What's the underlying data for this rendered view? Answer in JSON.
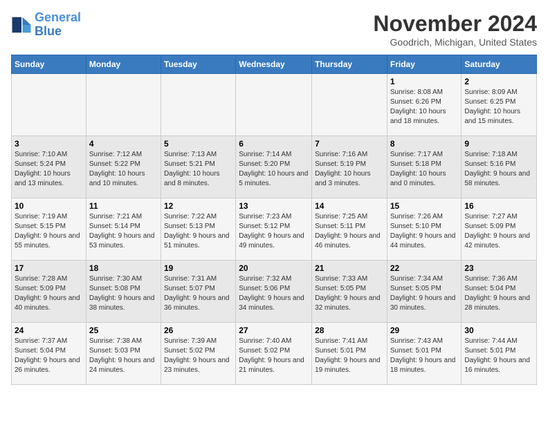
{
  "header": {
    "logo_line1": "General",
    "logo_line2": "Blue",
    "month": "November 2024",
    "location": "Goodrich, Michigan, United States"
  },
  "weekdays": [
    "Sunday",
    "Monday",
    "Tuesday",
    "Wednesday",
    "Thursday",
    "Friday",
    "Saturday"
  ],
  "weeks": [
    [
      {
        "day": "",
        "info": ""
      },
      {
        "day": "",
        "info": ""
      },
      {
        "day": "",
        "info": ""
      },
      {
        "day": "",
        "info": ""
      },
      {
        "day": "",
        "info": ""
      },
      {
        "day": "1",
        "info": "Sunrise: 8:08 AM\nSunset: 6:26 PM\nDaylight: 10 hours and 18 minutes."
      },
      {
        "day": "2",
        "info": "Sunrise: 8:09 AM\nSunset: 6:25 PM\nDaylight: 10 hours and 15 minutes."
      }
    ],
    [
      {
        "day": "3",
        "info": "Sunrise: 7:10 AM\nSunset: 5:24 PM\nDaylight: 10 hours and 13 minutes."
      },
      {
        "day": "4",
        "info": "Sunrise: 7:12 AM\nSunset: 5:22 PM\nDaylight: 10 hours and 10 minutes."
      },
      {
        "day": "5",
        "info": "Sunrise: 7:13 AM\nSunset: 5:21 PM\nDaylight: 10 hours and 8 minutes."
      },
      {
        "day": "6",
        "info": "Sunrise: 7:14 AM\nSunset: 5:20 PM\nDaylight: 10 hours and 5 minutes."
      },
      {
        "day": "7",
        "info": "Sunrise: 7:16 AM\nSunset: 5:19 PM\nDaylight: 10 hours and 3 minutes."
      },
      {
        "day": "8",
        "info": "Sunrise: 7:17 AM\nSunset: 5:18 PM\nDaylight: 10 hours and 0 minutes."
      },
      {
        "day": "9",
        "info": "Sunrise: 7:18 AM\nSunset: 5:16 PM\nDaylight: 9 hours and 58 minutes."
      }
    ],
    [
      {
        "day": "10",
        "info": "Sunrise: 7:19 AM\nSunset: 5:15 PM\nDaylight: 9 hours and 55 minutes."
      },
      {
        "day": "11",
        "info": "Sunrise: 7:21 AM\nSunset: 5:14 PM\nDaylight: 9 hours and 53 minutes."
      },
      {
        "day": "12",
        "info": "Sunrise: 7:22 AM\nSunset: 5:13 PM\nDaylight: 9 hours and 51 minutes."
      },
      {
        "day": "13",
        "info": "Sunrise: 7:23 AM\nSunset: 5:12 PM\nDaylight: 9 hours and 49 minutes."
      },
      {
        "day": "14",
        "info": "Sunrise: 7:25 AM\nSunset: 5:11 PM\nDaylight: 9 hours and 46 minutes."
      },
      {
        "day": "15",
        "info": "Sunrise: 7:26 AM\nSunset: 5:10 PM\nDaylight: 9 hours and 44 minutes."
      },
      {
        "day": "16",
        "info": "Sunrise: 7:27 AM\nSunset: 5:09 PM\nDaylight: 9 hours and 42 minutes."
      }
    ],
    [
      {
        "day": "17",
        "info": "Sunrise: 7:28 AM\nSunset: 5:09 PM\nDaylight: 9 hours and 40 minutes."
      },
      {
        "day": "18",
        "info": "Sunrise: 7:30 AM\nSunset: 5:08 PM\nDaylight: 9 hours and 38 minutes."
      },
      {
        "day": "19",
        "info": "Sunrise: 7:31 AM\nSunset: 5:07 PM\nDaylight: 9 hours and 36 minutes."
      },
      {
        "day": "20",
        "info": "Sunrise: 7:32 AM\nSunset: 5:06 PM\nDaylight: 9 hours and 34 minutes."
      },
      {
        "day": "21",
        "info": "Sunrise: 7:33 AM\nSunset: 5:05 PM\nDaylight: 9 hours and 32 minutes."
      },
      {
        "day": "22",
        "info": "Sunrise: 7:34 AM\nSunset: 5:05 PM\nDaylight: 9 hours and 30 minutes."
      },
      {
        "day": "23",
        "info": "Sunrise: 7:36 AM\nSunset: 5:04 PM\nDaylight: 9 hours and 28 minutes."
      }
    ],
    [
      {
        "day": "24",
        "info": "Sunrise: 7:37 AM\nSunset: 5:04 PM\nDaylight: 9 hours and 26 minutes."
      },
      {
        "day": "25",
        "info": "Sunrise: 7:38 AM\nSunset: 5:03 PM\nDaylight: 9 hours and 24 minutes."
      },
      {
        "day": "26",
        "info": "Sunrise: 7:39 AM\nSunset: 5:02 PM\nDaylight: 9 hours and 23 minutes."
      },
      {
        "day": "27",
        "info": "Sunrise: 7:40 AM\nSunset: 5:02 PM\nDaylight: 9 hours and 21 minutes."
      },
      {
        "day": "28",
        "info": "Sunrise: 7:41 AM\nSunset: 5:01 PM\nDaylight: 9 hours and 19 minutes."
      },
      {
        "day": "29",
        "info": "Sunrise: 7:43 AM\nSunset: 5:01 PM\nDaylight: 9 hours and 18 minutes."
      },
      {
        "day": "30",
        "info": "Sunrise: 7:44 AM\nSunset: 5:01 PM\nDaylight: 9 hours and 16 minutes."
      }
    ]
  ]
}
